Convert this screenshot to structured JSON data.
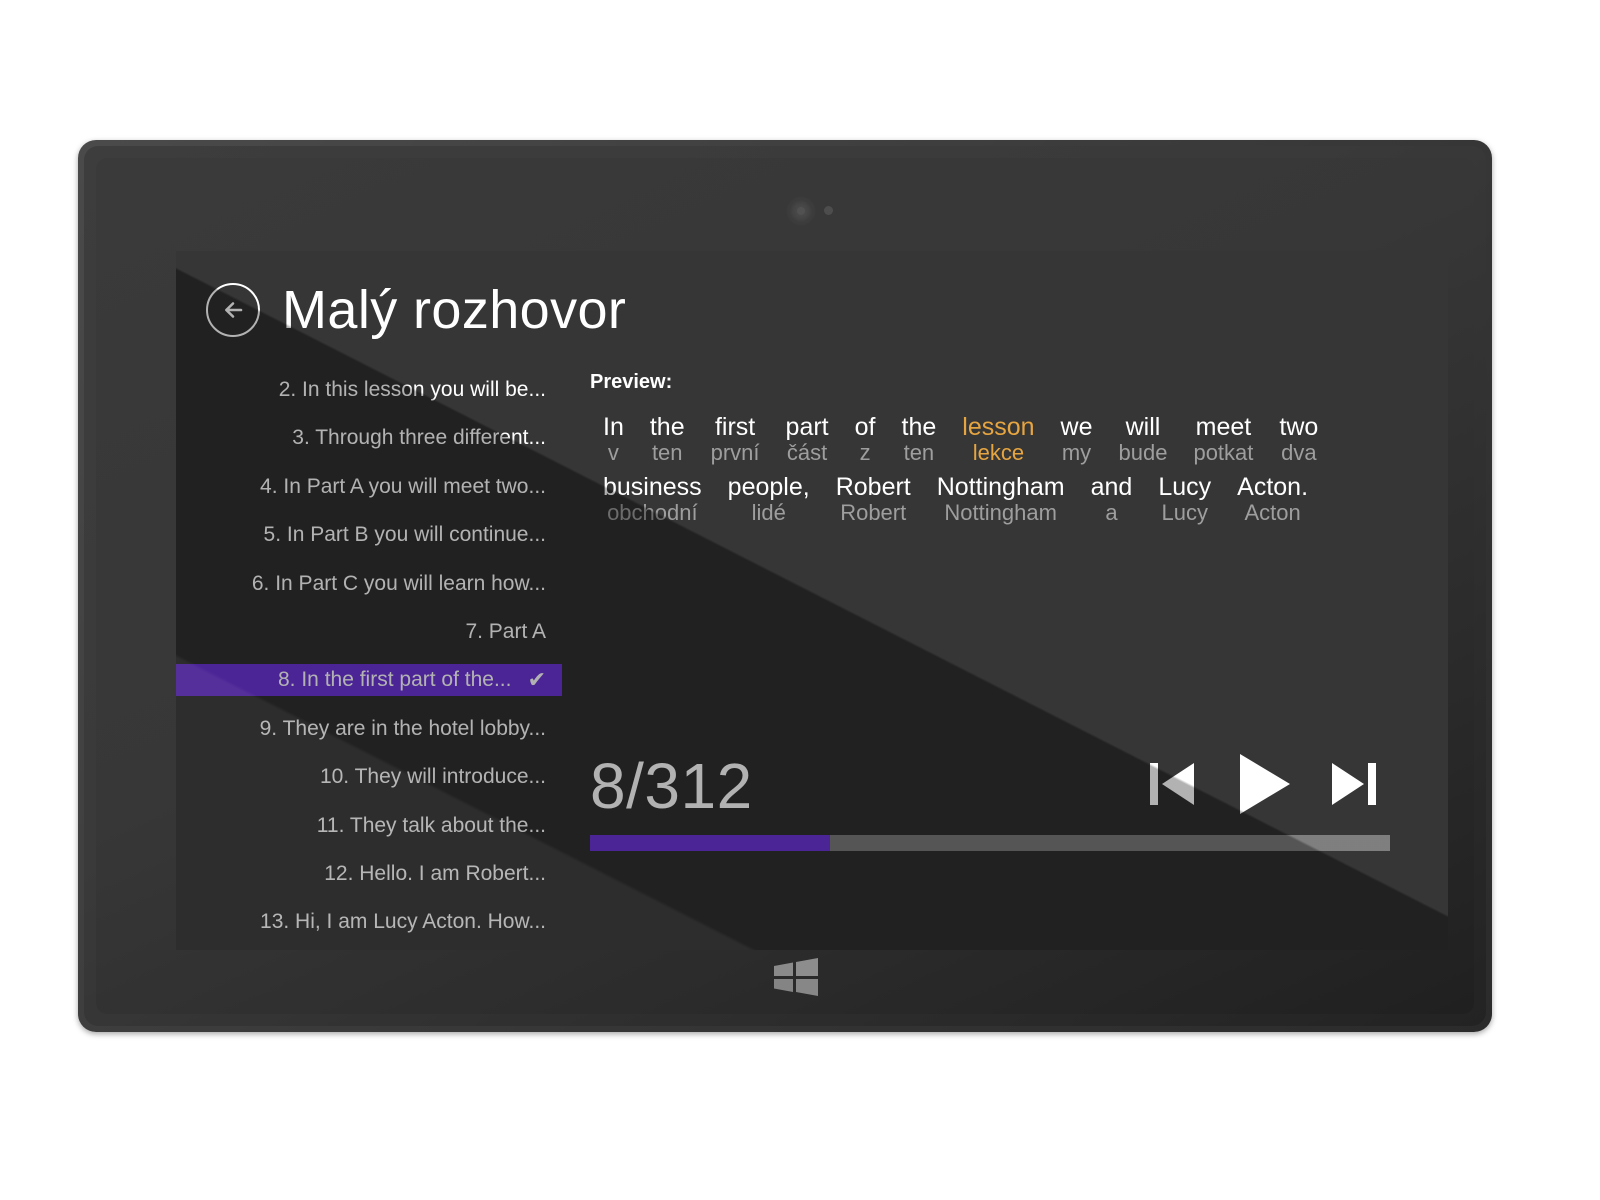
{
  "app": {
    "title": "Malý rozhovor",
    "back_icon": "back-arrow-icon",
    "accent_purple": "#6b33d6",
    "accent_orange": "#e5a23a",
    "screen_bg": "#2f2f2f"
  },
  "lesson_list": {
    "items": [
      {
        "label": "2. In this lesson you will be...",
        "selected": false
      },
      {
        "label": "3. Through three different...",
        "selected": false
      },
      {
        "label": "4. In Part A you will meet two...",
        "selected": false
      },
      {
        "label": "5. In Part B you will continue...",
        "selected": false
      },
      {
        "label": "6. In Part C you will learn how...",
        "selected": false
      },
      {
        "label": "7. Part A",
        "selected": false
      },
      {
        "label": "8. In the first part of the...",
        "selected": true,
        "check": "✔"
      },
      {
        "label": "9. They are in the hotel lobby...",
        "selected": false
      },
      {
        "label": "10. They will introduce...",
        "selected": false
      },
      {
        "label": "11. They talk about the...",
        "selected": false
      },
      {
        "label": "12. Hello. I am Robert...",
        "selected": false
      },
      {
        "label": "13. Hi, I am Lucy Acton. How...",
        "selected": false
      }
    ]
  },
  "preview": {
    "label": "Preview:",
    "rows": [
      [
        {
          "en": "In",
          "cs": "v",
          "highlight": false
        },
        {
          "en": "the",
          "cs": "ten",
          "highlight": false
        },
        {
          "en": "first",
          "cs": "první",
          "highlight": false
        },
        {
          "en": "part",
          "cs": "část",
          "highlight": false
        },
        {
          "en": "of",
          "cs": "z",
          "highlight": false
        },
        {
          "en": "the",
          "cs": "ten",
          "highlight": false
        },
        {
          "en": "lesson",
          "cs": "lekce",
          "highlight": true
        },
        {
          "en": "we",
          "cs": "my",
          "highlight": false
        },
        {
          "en": "will",
          "cs": "bude",
          "highlight": false
        },
        {
          "en": "meet",
          "cs": "potkat",
          "highlight": false
        },
        {
          "en": "two",
          "cs": "dva",
          "highlight": false
        }
      ],
      [
        {
          "en": "business",
          "cs": "obchodní",
          "highlight": false
        },
        {
          "en": "people,",
          "cs": "lidé",
          "highlight": false
        },
        {
          "en": "Robert",
          "cs": "Robert",
          "highlight": false
        },
        {
          "en": "Nottingham",
          "cs": "Nottingham",
          "highlight": false
        },
        {
          "en": "and",
          "cs": "a",
          "highlight": false
        },
        {
          "en": "Lucy",
          "cs": "Lucy",
          "highlight": false
        },
        {
          "en": "Acton.",
          "cs": "Acton",
          "highlight": false
        }
      ]
    ]
  },
  "player": {
    "counter": "8/312",
    "current": 8,
    "total": 312,
    "progress_percent": 30,
    "previous_icon": "skip-previous-icon",
    "play_icon": "play-icon",
    "next_icon": "skip-next-icon"
  },
  "device": {
    "camera_icon": "front-camera-icon",
    "sensor_icon": "light-sensor-icon",
    "home_icon": "windows-logo-icon"
  }
}
